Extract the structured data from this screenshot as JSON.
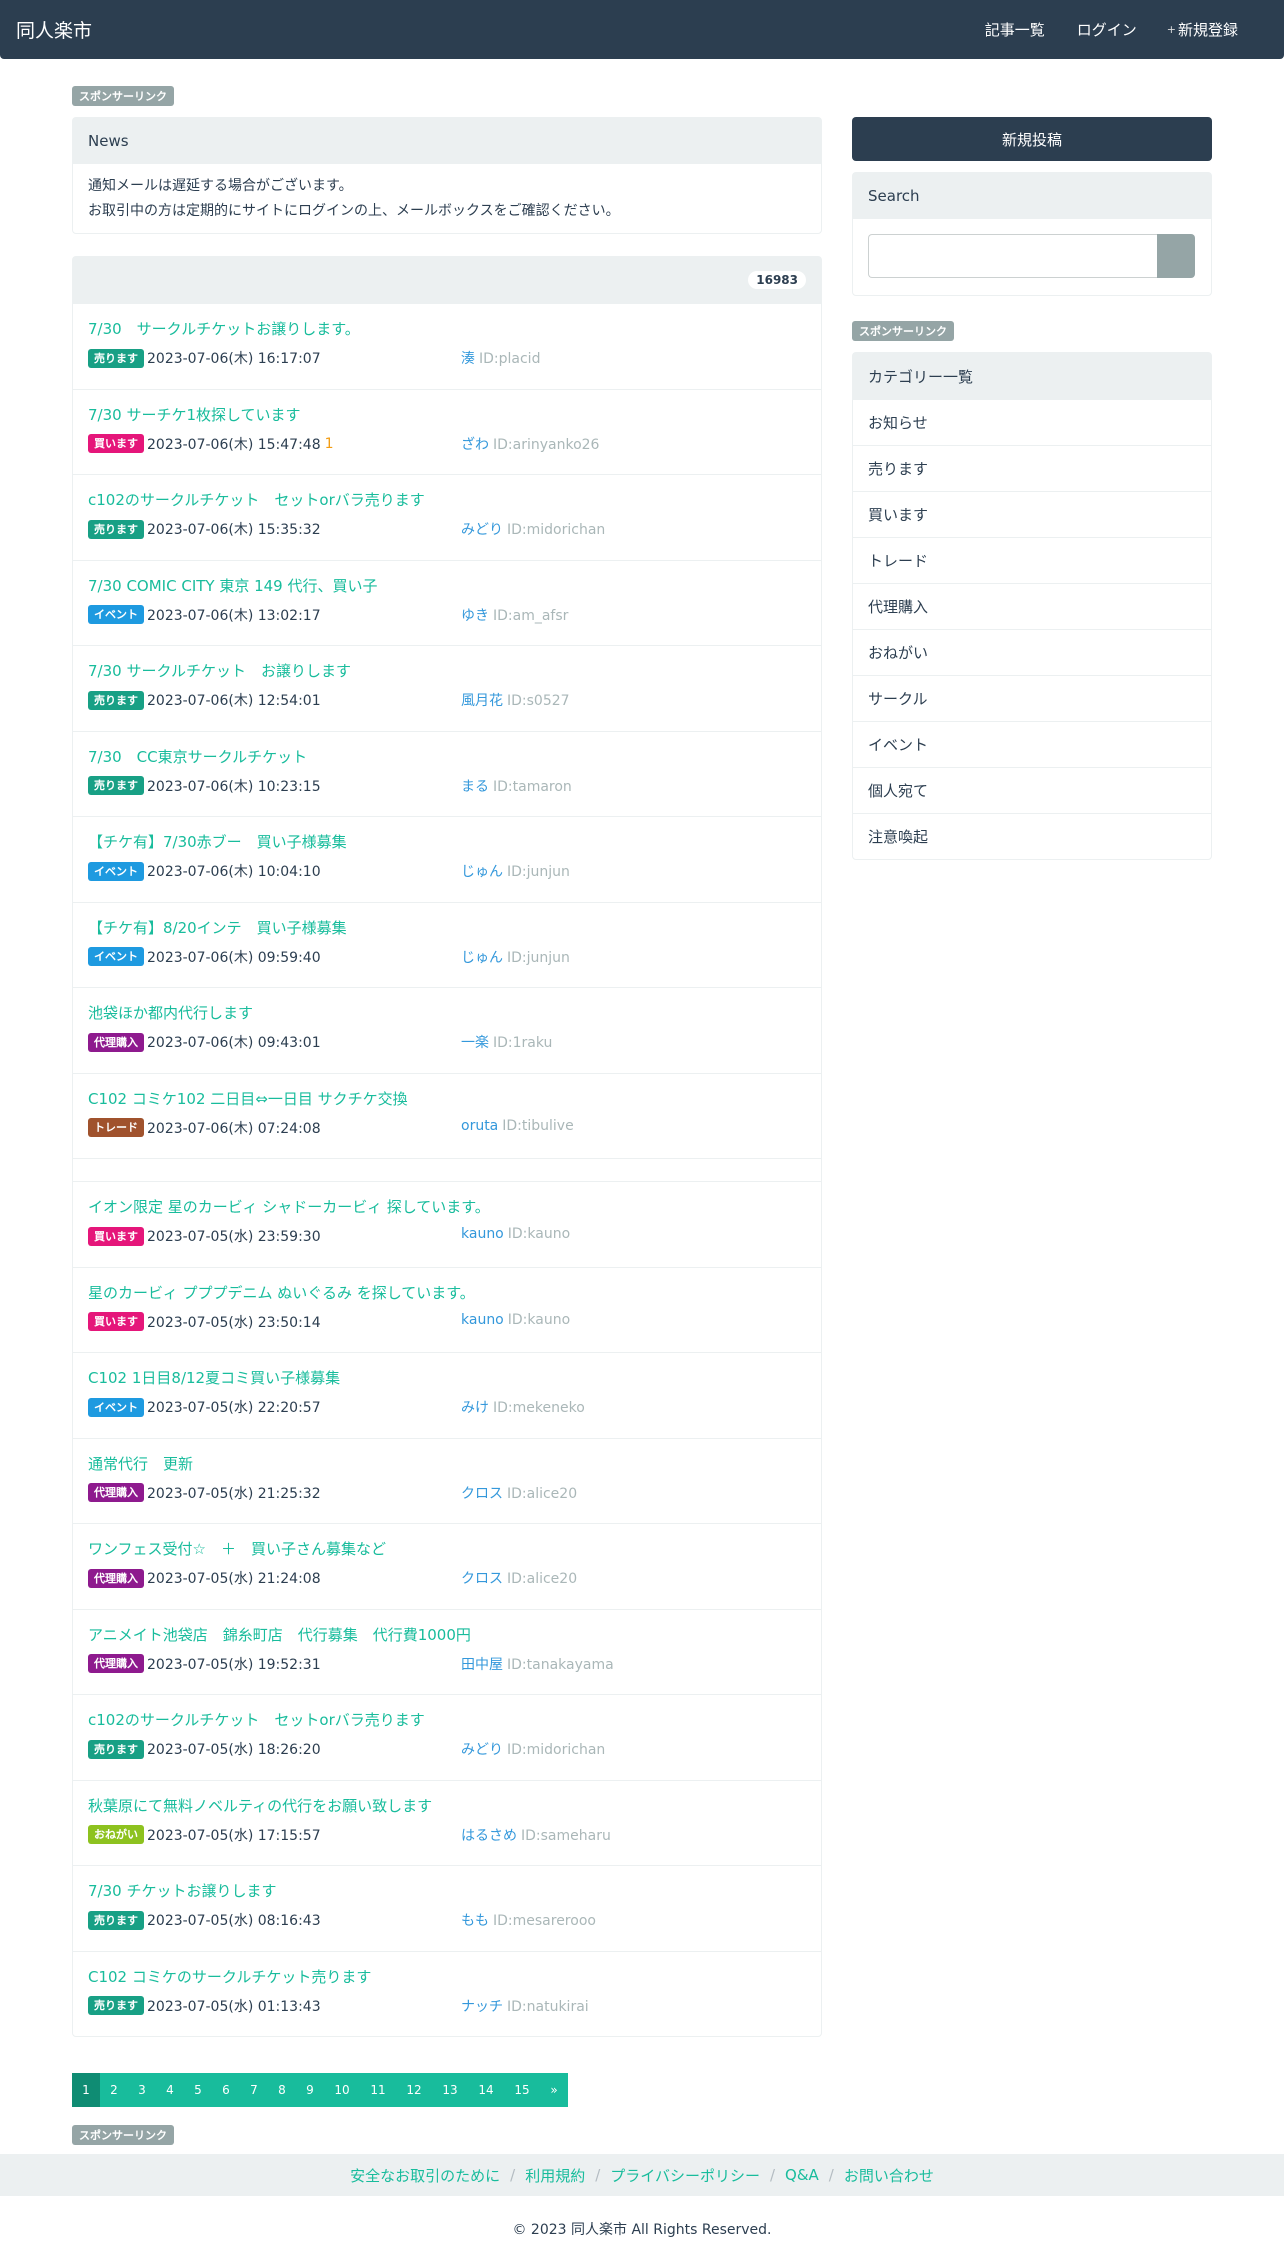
{
  "nav": {
    "brand": "同人楽市",
    "links": [
      {
        "icon": "",
        "label": "記事一覧"
      },
      {
        "icon": "",
        "label": "ログイン"
      },
      {
        "icon": "+",
        "label": "新規登録"
      }
    ]
  },
  "sponsor_label": "スポンサーリンク",
  "news": {
    "title": "News",
    "lines": [
      "通知メールは遅延する場合がございます。",
      "お取引中の方は定期的にサイトにログインの上、メールボックスをご確認ください。"
    ]
  },
  "posts_count": "16983",
  "user_icon": "",
  "posts_group1": [
    {
      "title": "7/30　サークルチケットお譲りします。",
      "label": "売ります",
      "label_type": "sell",
      "date": "2023-07-06(木) 16:17:07",
      "replies": "",
      "user": "湊",
      "id": "ID:placid"
    },
    {
      "title": "7/30 サーチケ1枚探しています",
      "label": "買います",
      "label_type": "buy",
      "date": "2023-07-06(木) 15:47:48",
      "replies": " 1",
      "user": "ざわ",
      "id": "ID:arinyanko26"
    },
    {
      "title": "c102のサークルチケット　セットorバラ売ります",
      "label": "売ります",
      "label_type": "sell",
      "date": "2023-07-06(木) 15:35:32",
      "replies": "",
      "user": "みどり",
      "id": "ID:midorichan"
    },
    {
      "title": "7/30 COMIC CITY 東京 149 代行、買い子",
      "label": "イベント",
      "label_type": "event",
      "date": "2023-07-06(木) 13:02:17",
      "replies": "",
      "user": "ゆき",
      "id": "ID:am_afsr"
    },
    {
      "title": "7/30 サークルチケット　お譲りします",
      "label": "売ります",
      "label_type": "sell",
      "date": "2023-07-06(木) 12:54:01",
      "replies": "",
      "user": "風月花",
      "id": "ID:s0527"
    },
    {
      "title": "7/30　CC東京サークルチケット",
      "label": "売ります",
      "label_type": "sell",
      "date": "2023-07-06(木) 10:23:15",
      "replies": "",
      "user": "まる",
      "id": "ID:tamaron"
    },
    {
      "title": "【チケ有】7/30赤ブー　買い子様募集",
      "label": "イベント",
      "label_type": "event",
      "date": "2023-07-06(木) 10:04:10",
      "replies": "",
      "user": "じゅん",
      "id": "ID:junjun"
    },
    {
      "title": "【チケ有】8/20インテ　買い子様募集",
      "label": "イベント",
      "label_type": "event",
      "date": "2023-07-06(木) 09:59:40",
      "replies": "",
      "user": "じゅん",
      "id": "ID:junjun"
    },
    {
      "title": "池袋ほか都内代行します",
      "label": "代理購入",
      "label_type": "proxy",
      "date": "2023-07-06(木) 09:43:01",
      "replies": "",
      "user": "一楽",
      "id": "ID:1raku"
    },
    {
      "title": "C102 コミケ102 二日目⇔一日目 サクチケ交換",
      "label": "トレード",
      "label_type": "trade",
      "date": "2023-07-06(木) 07:24:08",
      "replies": "",
      "user": "oruta",
      "id": "ID:tibulive"
    }
  ],
  "posts_group2": [
    {
      "title": "イオン限定 星のカービィ シャドーカービィ 探しています。",
      "label": "買います",
      "label_type": "buy",
      "date": "2023-07-05(水) 23:59:30",
      "replies": "",
      "user": "kauno",
      "id": "ID:kauno"
    },
    {
      "title": "星のカービィ プププデニム ぬいぐるみ を探しています。",
      "label": "買います",
      "label_type": "buy",
      "date": "2023-07-05(水) 23:50:14",
      "replies": "",
      "user": "kauno",
      "id": "ID:kauno"
    },
    {
      "title": "C102 1日目8/12夏コミ買い子様募集",
      "label": "イベント",
      "label_type": "event",
      "date": "2023-07-05(水) 22:20:57",
      "replies": "",
      "user": "みけ",
      "id": "ID:mekeneko"
    },
    {
      "title": "通常代行　更新",
      "label": "代理購入",
      "label_type": "proxy",
      "date": "2023-07-05(水) 21:25:32",
      "replies": "",
      "user": "クロス",
      "id": "ID:alice20"
    },
    {
      "title": "ワンフェス受付☆　＋　買い子さん募集など",
      "label": "代理購入",
      "label_type": "proxy",
      "date": "2023-07-05(水) 21:24:08",
      "replies": "",
      "user": "クロス",
      "id": "ID:alice20"
    },
    {
      "title": "アニメイト池袋店　錦糸町店　代行募集　代行費1000円",
      "label": "代理購入",
      "label_type": "proxy",
      "date": "2023-07-05(水) 19:52:31",
      "replies": "",
      "user": "田中屋",
      "id": "ID:tanakayama"
    },
    {
      "title": "c102のサークルチケット　セットorバラ売ります",
      "label": "売ります",
      "label_type": "sell",
      "date": "2023-07-05(水) 18:26:20",
      "replies": "",
      "user": "みどり",
      "id": "ID:midorichan"
    },
    {
      "title": "秋葉原にて無料ノベルティの代行をお願い致します",
      "label": "おねがい",
      "label_type": "ask",
      "date": "2023-07-05(水) 17:15:57",
      "replies": "",
      "user": "はるさめ",
      "id": "ID:sameharu"
    },
    {
      "title": "7/30 チケットお譲りします",
      "label": "売ります",
      "label_type": "sell",
      "date": "2023-07-05(水) 08:16:43",
      "replies": "",
      "user": "もも",
      "id": "ID:mesarerooo"
    },
    {
      "title": "C102 コミケのサークルチケット売ります",
      "label": "売ります",
      "label_type": "sell",
      "date": "2023-07-05(水) 01:13:43",
      "replies": "",
      "user": "ナッチ",
      "id": "ID:natukirai"
    }
  ],
  "pagination": [
    "1",
    "2",
    "3",
    "4",
    "5",
    "6",
    "7",
    "8",
    "9",
    "10",
    "11",
    "12",
    "13",
    "14",
    "15",
    "»"
  ],
  "pagination_active": "1",
  "sidebar": {
    "post_button": "新規投稿",
    "search_title": "Search",
    "search_icon": "",
    "category_title": "カテゴリー一覧",
    "categories": [
      "お知らせ",
      "売ります",
      "買います",
      "トレード",
      "代理購入",
      "おねがい",
      "サークル",
      "イベント",
      "個人宛て",
      "注意喚起"
    ]
  },
  "footer": {
    "links": [
      "安全なお取引のために",
      "利用規約",
      "プライバシーポリシー",
      "Q&A",
      "お問い合わせ"
    ],
    "copyright": "© 2023 同人楽市 All Rights Reserved."
  },
  "colors": {
    "navbar": "#2c3e50",
    "accent": "#18bc9c",
    "user_link": "#3498db",
    "label_sell": "#18a085",
    "label_buy": "#e5167a",
    "label_event": "#1e9ae0",
    "label_proxy": "#8e1a8e",
    "label_trade": "#a0522d",
    "label_ask": "#8dc21f"
  }
}
